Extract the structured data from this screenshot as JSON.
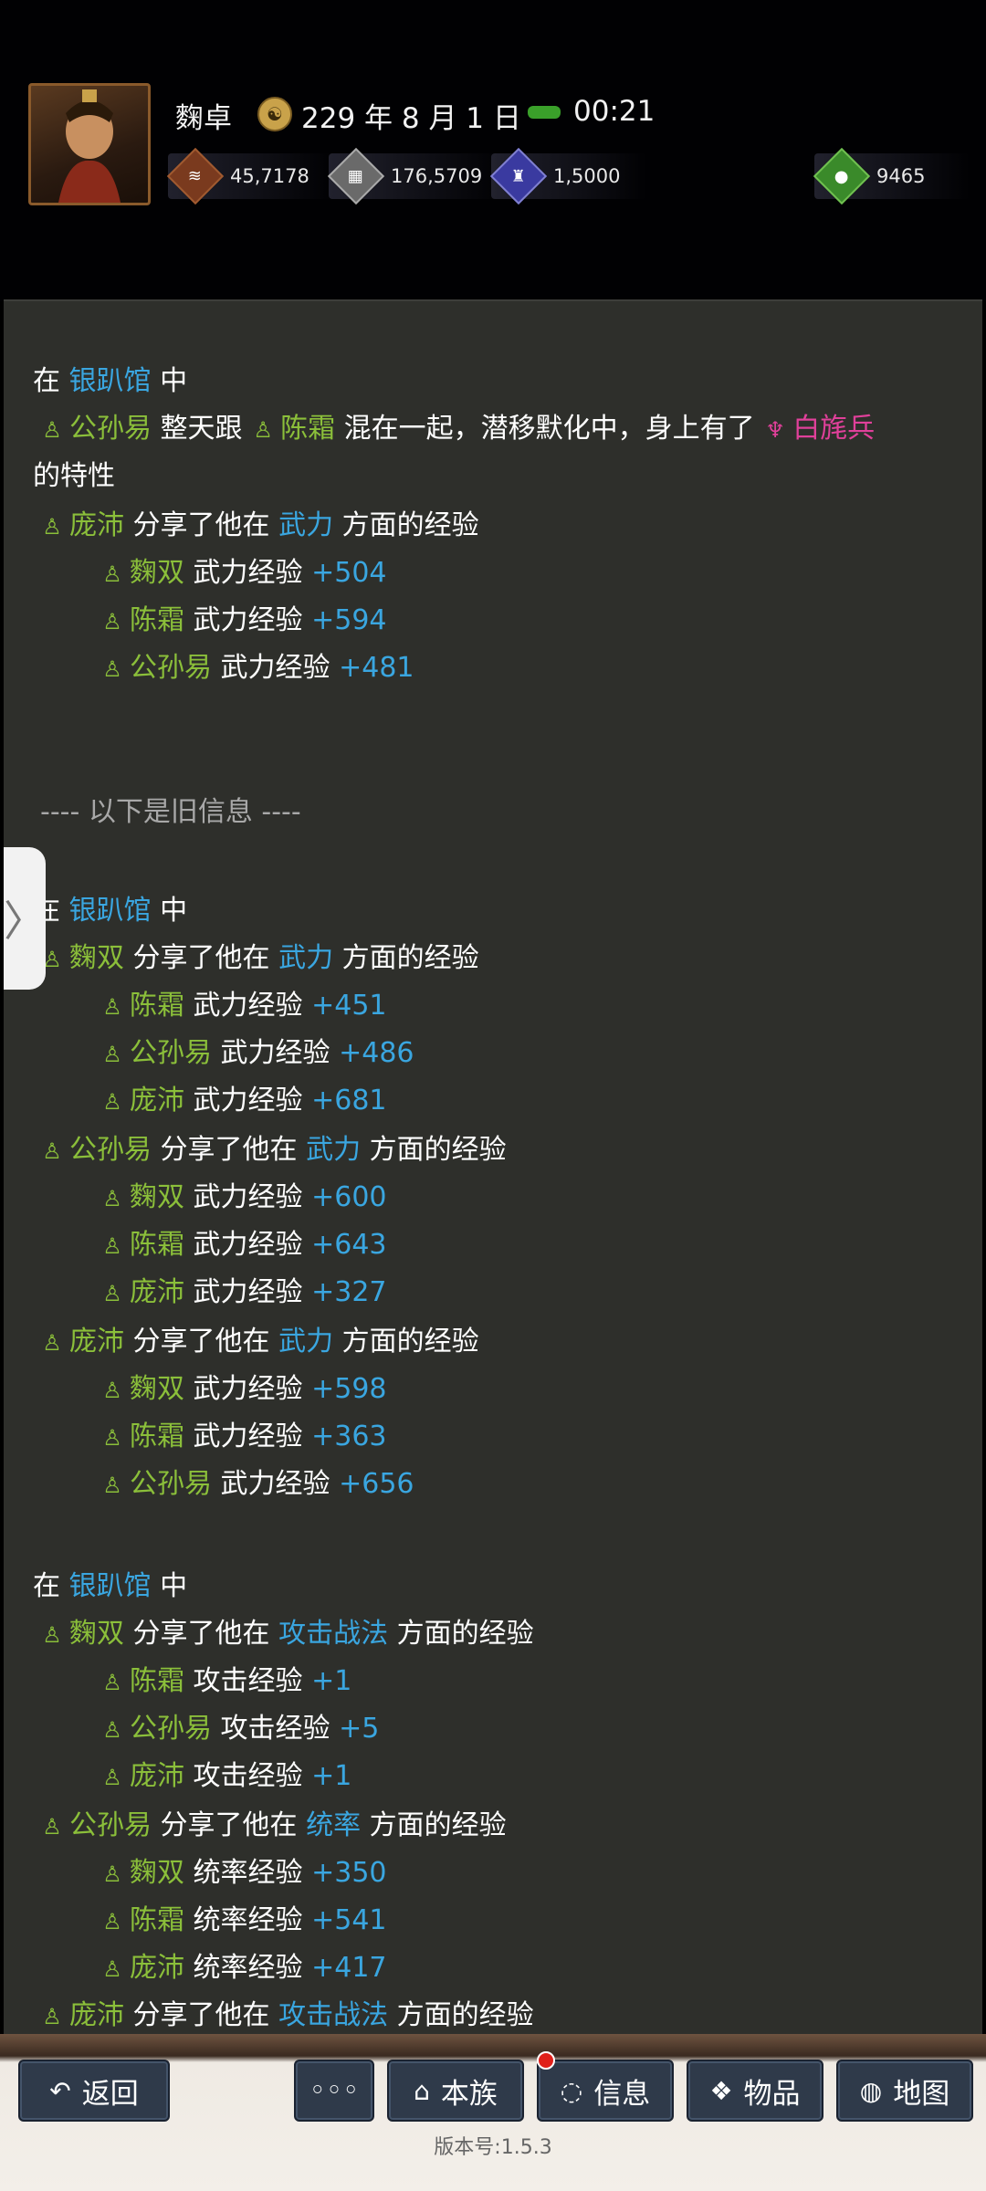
{
  "header": {
    "name": "麴卓",
    "date": "229 年 8 月 1 日",
    "time": "00:21",
    "resources": [
      {
        "icon": "coin-icon",
        "value": "45,7178",
        "color": "#7a3a1e"
      },
      {
        "icon": "grain-icon",
        "value": "176,5709",
        "color": "#8a8a8a"
      },
      {
        "icon": "soldier-icon",
        "value": "1,5000",
        "color": "#3a3aa0"
      },
      {
        "icon": "money-bag-icon",
        "value": "9465",
        "color": "#3a8a2a"
      }
    ]
  },
  "log": {
    "block1": {
      "at": "在",
      "place": "银趴馆",
      "zhong": "中",
      "p1": "公孙易",
      "m1": "整天跟",
      "p2": "陈霜",
      "m2": "混在一起，潜移默化中，身上有了",
      "trait": "白旄兵",
      "m3": "的特性",
      "share": {
        "who": "庞沛",
        "pre": "分享了他在",
        "skill": "武力",
        "post": "方面的经验"
      },
      "gains": [
        {
          "who": "麴双",
          "stat": "武力经验",
          "val": "+504"
        },
        {
          "who": "陈霜",
          "stat": "武力经验",
          "val": "+594"
        },
        {
          "who": "公孙易",
          "stat": "武力经验",
          "val": "+481"
        }
      ]
    },
    "old_divider": "---- 以下是旧信息 ----",
    "block2": {
      "at": "在",
      "place": "银趴馆",
      "zhong": "中",
      "shares": [
        {
          "who": "麴双",
          "pre": "分享了他在",
          "skill": "武力",
          "post": "方面的经验",
          "gains": [
            {
              "who": "陈霜",
              "stat": "武力经验",
              "val": "+451"
            },
            {
              "who": "公孙易",
              "stat": "武力经验",
              "val": "+486"
            },
            {
              "who": "庞沛",
              "stat": "武力经验",
              "val": "+681"
            }
          ]
        },
        {
          "who": "公孙易",
          "pre": "分享了他在",
          "skill": "武力",
          "post": "方面的经验",
          "gains": [
            {
              "who": "麴双",
              "stat": "武力经验",
              "val": "+600"
            },
            {
              "who": "陈霜",
              "stat": "武力经验",
              "val": "+643"
            },
            {
              "who": "庞沛",
              "stat": "武力经验",
              "val": "+327"
            }
          ]
        },
        {
          "who": "庞沛",
          "pre": "分享了他在",
          "skill": "武力",
          "post": "方面的经验",
          "gains": [
            {
              "who": "麴双",
              "stat": "武力经验",
              "val": "+598"
            },
            {
              "who": "陈霜",
              "stat": "武力经验",
              "val": "+363"
            },
            {
              "who": "公孙易",
              "stat": "武力经验",
              "val": "+656"
            }
          ]
        }
      ]
    },
    "block3": {
      "at": "在",
      "place": "银趴馆",
      "zhong": "中",
      "shares": [
        {
          "who": "麴双",
          "pre": "分享了他在",
          "skill": "攻击战法",
          "post": "方面的经验",
          "gains": [
            {
              "who": "陈霜",
              "stat": "攻击经验",
              "val": "+1"
            },
            {
              "who": "公孙易",
              "stat": "攻击经验",
              "val": "+5"
            },
            {
              "who": "庞沛",
              "stat": "攻击经验",
              "val": "+1"
            }
          ]
        },
        {
          "who": "公孙易",
          "pre": "分享了他在",
          "skill": "统率",
          "post": "方面的经验",
          "gains": [
            {
              "who": "麴双",
              "stat": "统率经验",
              "val": "+350"
            },
            {
              "who": "陈霜",
              "stat": "统率经验",
              "val": "+541"
            },
            {
              "who": "庞沛",
              "stat": "统率经验",
              "val": "+417"
            }
          ]
        },
        {
          "who": "庞沛",
          "pre": "分享了他在",
          "skill": "攻击战法",
          "post": "方面的经验",
          "gains": []
        }
      ]
    }
  },
  "nav": {
    "back": "返回",
    "more": "◦◦◦",
    "clan": "本族",
    "info": "信息",
    "items": "物品",
    "map": "地图",
    "version": "版本号:1.5.3"
  }
}
